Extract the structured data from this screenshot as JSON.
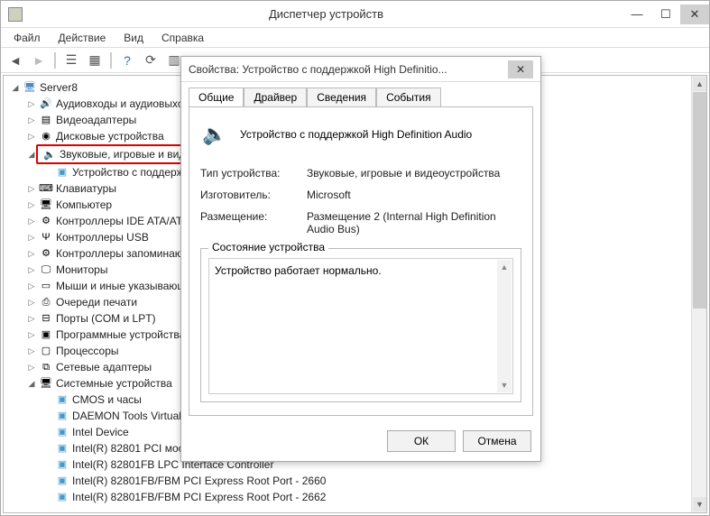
{
  "window": {
    "title": "Диспетчер устройств"
  },
  "menu": {
    "file": "Файл",
    "action": "Действие",
    "view": "Вид",
    "help": "Справка"
  },
  "tree": {
    "root": "Server8",
    "items": [
      {
        "icon": "🔊",
        "label": "Аудиовходы и аудиовыходы",
        "exp": "▷"
      },
      {
        "icon": "▤",
        "label": "Видеоадаптеры",
        "exp": "▷"
      },
      {
        "icon": "◉",
        "label": "Дисковые устройства",
        "exp": "▷"
      },
      {
        "icon": "🔈",
        "label": "Звуковые, игровые и видеоустройства",
        "exp": "◢",
        "highlight": true,
        "children": [
          {
            "label": "Устройство с поддержкой High Definition Audio"
          }
        ]
      },
      {
        "icon": "⌨",
        "label": "Клавиатуры",
        "exp": "▷"
      },
      {
        "icon": "🖥",
        "label": "Компьютер",
        "exp": "▷"
      },
      {
        "icon": "⚙",
        "label": "Контроллеры IDE ATA/ATAPI",
        "exp": "▷"
      },
      {
        "icon": "Ψ",
        "label": "Контроллеры USB",
        "exp": "▷"
      },
      {
        "icon": "⚙",
        "label": "Контроллеры запоминающих устройств",
        "exp": "▷"
      },
      {
        "icon": "🖵",
        "label": "Мониторы",
        "exp": "▷"
      },
      {
        "icon": "▭",
        "label": "Мыши и иные указывающие устройства",
        "exp": "▷"
      },
      {
        "icon": "⎙",
        "label": "Очереди печати",
        "exp": "▷"
      },
      {
        "icon": "⊟",
        "label": "Порты (COM и LPT)",
        "exp": "▷"
      },
      {
        "icon": "▣",
        "label": "Программные устройства",
        "exp": "▷"
      },
      {
        "icon": "▢",
        "label": "Процессоры",
        "exp": "▷"
      },
      {
        "icon": "⧉",
        "label": "Сетевые адаптеры",
        "exp": "▷"
      },
      {
        "icon": "🖥",
        "label": "Системные устройства",
        "exp": "◢",
        "children": [
          {
            "label": "CMOS и часы"
          },
          {
            "label": "DAEMON Tools Virtual Bus"
          },
          {
            "label": "Intel Device"
          },
          {
            "label": "Intel(R) 82801 PCI мост - 244E"
          },
          {
            "label": "Intel(R) 82801FB LPC Interface Controller"
          },
          {
            "label": "Intel(R) 82801FB/FBM PCI Express Root Port - 2660"
          },
          {
            "label": "Intel(R) 82801FB/FBM PCI Express Root Port - 2662"
          }
        ]
      }
    ]
  },
  "dialog": {
    "title": "Свойства: Устройство с поддержкой High Definitio...",
    "tabs": {
      "general": "Общие",
      "driver": "Драйвер",
      "details": "Сведения",
      "events": "События"
    },
    "device_name": "Устройство с поддержкой High Definition Audio",
    "labels": {
      "type": "Тип устройства:",
      "mfg": "Изготовитель:",
      "loc": "Размещение:"
    },
    "values": {
      "type": "Звуковые, игровые и видеоустройства",
      "mfg": "Microsoft",
      "loc": "Размещение 2 (Internal High Definition Audio Bus)"
    },
    "status_group": "Состояние устройства",
    "status_text": "Устройство работает нормально.",
    "ok": "ОК",
    "cancel": "Отмена"
  }
}
